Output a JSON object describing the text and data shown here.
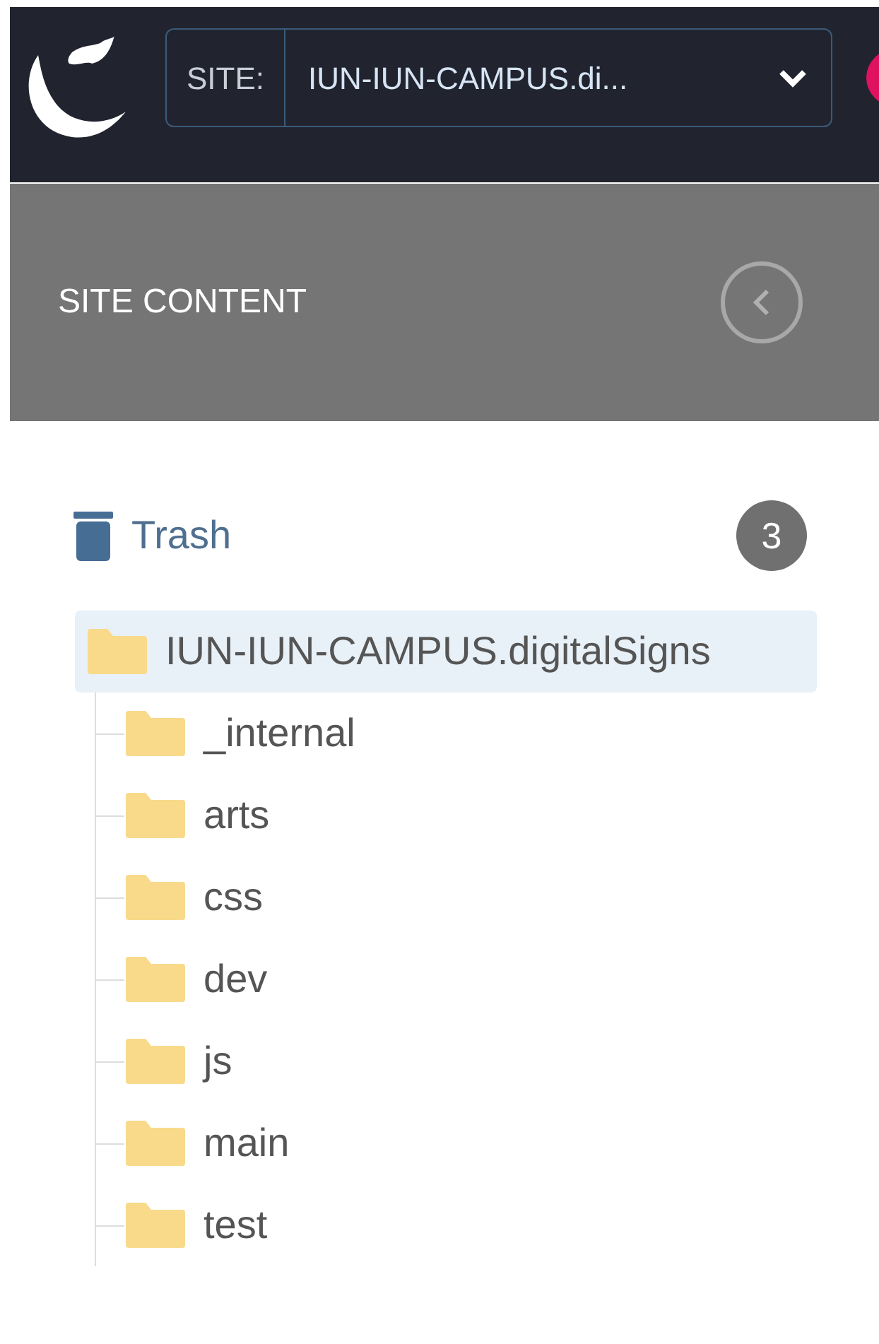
{
  "header": {
    "site_label": "SITE:",
    "site_value": "IUN-IUN-CAMPUS.di..."
  },
  "panel": {
    "title": "SITE CONTENT"
  },
  "trash": {
    "label": "Trash",
    "count": "3"
  },
  "tree": [
    {
      "label": "IUN-IUN-CAMPUS.digitalSigns",
      "selected": true,
      "children": [
        {
          "label": "_internal",
          "selected": false
        },
        {
          "label": "arts",
          "selected": false
        },
        {
          "label": "css",
          "selected": false
        },
        {
          "label": "dev",
          "selected": false
        },
        {
          "label": "js",
          "selected": false
        },
        {
          "label": "main",
          "selected": false
        },
        {
          "label": "test",
          "selected": false
        }
      ]
    }
  ]
}
